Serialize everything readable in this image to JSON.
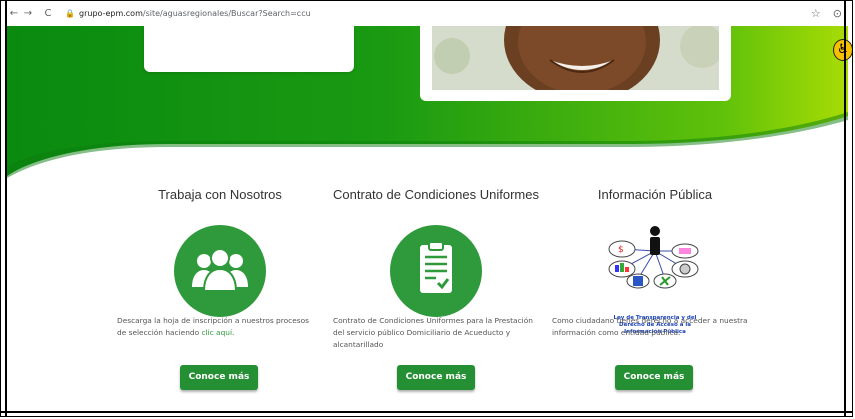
{
  "browser": {
    "url_domain": "grupo-epm.com",
    "url_path": "/site/aguasregionales/Buscar?Search=ccu",
    "back_glyph": "←",
    "forward_glyph": "→",
    "reload_glyph": "C",
    "lock_glyph": "🔒",
    "star_glyph": "☆",
    "account_glyph": "⊙"
  },
  "accessibility": {
    "glyph": "♿"
  },
  "colors": {
    "brand_green": "#2e9a3c",
    "button_green": "#258f34",
    "light_green": "#8fd400"
  },
  "sections": [
    {
      "title": "Trabaja con Nosotros",
      "icon": "people-group-icon",
      "description_text": "Descarga la hoja de inscripción a nuestros procesos de selección haciendo ",
      "description_link": "clic aquí",
      "description_end": ".",
      "button": "Conoce más"
    },
    {
      "title": "Contrato de Condiciones Uniformes",
      "icon": "clipboard-check-icon",
      "description_text": "Contrato de Condiciones Uniformes para la Prestación del servicio público Domiciliario de Acueducto y alcantarillado",
      "button": "Conoce más"
    },
    {
      "title": "Información Pública",
      "icon": "transparency-law-graphic",
      "graphic_caption": "Ley de Transparencia y del Derecho de Acceso a la Información Pública",
      "description_text": "Como ciudadano tienes derecho a acceder a nuestra información como entidad pública.",
      "button": "Conoce más"
    }
  ]
}
